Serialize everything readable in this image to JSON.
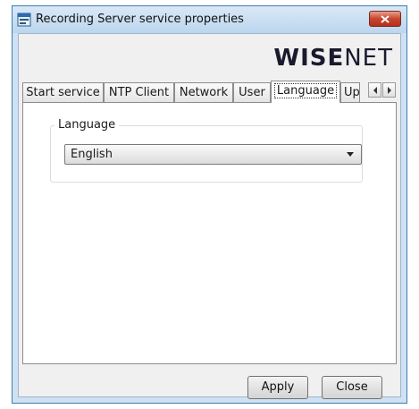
{
  "window": {
    "title": "Recording Server service properties",
    "close_label": "✕"
  },
  "brand": {
    "part1": "WISE",
    "part2": "NET"
  },
  "tabs": [
    {
      "label": "Start service",
      "active": false
    },
    {
      "label": "NTP Client",
      "active": false
    },
    {
      "label": "Network",
      "active": false
    },
    {
      "label": "User",
      "active": false
    },
    {
      "label": "Language",
      "active": true
    },
    {
      "label": "Up",
      "active": false
    }
  ],
  "language": {
    "group_label": "Language",
    "selected": "English"
  },
  "buttons": {
    "apply": "Apply",
    "close": "Close"
  },
  "colors": {
    "accent": "#3c7fb1",
    "close_button": "#c7452f"
  }
}
